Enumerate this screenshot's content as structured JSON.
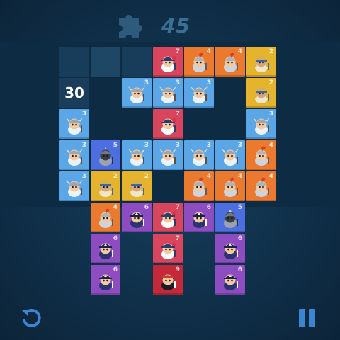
{
  "hud": {
    "moves_left": "45",
    "puzzle_icon": "puzzle-piece-icon"
  },
  "board": {
    "timer": "30",
    "columns": 7,
    "rows": 8,
    "tiles": [
      {
        "row": 0,
        "col": 0,
        "kind": "dark2"
      },
      {
        "row": 0,
        "col": 1,
        "kind": "dark"
      },
      {
        "row": 0,
        "col": 2,
        "kind": "dark2"
      },
      {
        "row": 0,
        "col": 3,
        "kind": "pink",
        "unit": "musketeer",
        "level": "7"
      },
      {
        "row": 0,
        "col": 4,
        "kind": "orange",
        "unit": "knight",
        "level": "4"
      },
      {
        "row": 0,
        "col": 5,
        "kind": "orange",
        "unit": "knight",
        "level": "4"
      },
      {
        "row": 0,
        "col": 6,
        "kind": "yellow",
        "unit": "pharaoh",
        "level": "2"
      },
      {
        "row": 1,
        "col": 0,
        "kind": "timer"
      },
      {
        "row": 1,
        "col": 2,
        "kind": "blue",
        "unit": "viking",
        "level": "3"
      },
      {
        "row": 1,
        "col": 3,
        "kind": "blue",
        "unit": "viking",
        "level": "3"
      },
      {
        "row": 1,
        "col": 4,
        "kind": "blue",
        "unit": "viking",
        "level": "3"
      },
      {
        "row": 1,
        "col": 6,
        "kind": "yellow",
        "unit": "pharaoh",
        "level": "2"
      },
      {
        "row": 2,
        "col": 0,
        "kind": "blue",
        "unit": "viking",
        "level": "3"
      },
      {
        "row": 2,
        "col": 3,
        "kind": "pink",
        "unit": "musketeer",
        "level": "7"
      },
      {
        "row": 2,
        "col": 6,
        "kind": "blue",
        "unit": "viking",
        "level": "3"
      },
      {
        "row": 3,
        "col": 0,
        "kind": "blue",
        "unit": "viking",
        "level": "3"
      },
      {
        "row": 3,
        "col": 1,
        "kind": "steel",
        "unit": "armor",
        "level": "5"
      },
      {
        "row": 3,
        "col": 2,
        "kind": "blue",
        "unit": "viking",
        "level": "3"
      },
      {
        "row": 3,
        "col": 3,
        "kind": "blue",
        "unit": "viking",
        "level": "3"
      },
      {
        "row": 3,
        "col": 4,
        "kind": "blue",
        "unit": "viking",
        "level": "3"
      },
      {
        "row": 3,
        "col": 5,
        "kind": "blue",
        "unit": "viking",
        "level": "3"
      },
      {
        "row": 3,
        "col": 6,
        "kind": "orange",
        "unit": "knight",
        "level": "4"
      },
      {
        "row": 4,
        "col": 0,
        "kind": "blue",
        "unit": "viking",
        "level": "3"
      },
      {
        "row": 4,
        "col": 1,
        "kind": "yellow",
        "unit": "pharaoh",
        "level": "2"
      },
      {
        "row": 4,
        "col": 2,
        "kind": "yellow",
        "unit": "pharaoh",
        "level": "2"
      },
      {
        "row": 4,
        "col": 4,
        "kind": "orange",
        "unit": "knight",
        "level": "4"
      },
      {
        "row": 4,
        "col": 5,
        "kind": "orange",
        "unit": "knight",
        "level": "4"
      },
      {
        "row": 4,
        "col": 6,
        "kind": "orange",
        "unit": "knight",
        "level": "4"
      },
      {
        "row": 5,
        "col": 1,
        "kind": "orange",
        "unit": "knight",
        "level": "4"
      },
      {
        "row": 5,
        "col": 2,
        "kind": "purple",
        "unit": "pirate",
        "level": "6"
      },
      {
        "row": 5,
        "col": 3,
        "kind": "pink",
        "unit": "musketeer",
        "level": "7"
      },
      {
        "row": 5,
        "col": 4,
        "kind": "purple",
        "unit": "pirate",
        "level": "6"
      },
      {
        "row": 5,
        "col": 5,
        "kind": "steel",
        "unit": "armor",
        "level": "5"
      },
      {
        "row": 6,
        "col": 1,
        "kind": "purple",
        "unit": "pirate",
        "level": "6"
      },
      {
        "row": 6,
        "col": 3,
        "kind": "pink",
        "unit": "musketeer",
        "level": "7"
      },
      {
        "row": 6,
        "col": 5,
        "kind": "purple",
        "unit": "pirate",
        "level": "6"
      },
      {
        "row": 7,
        "col": 1,
        "kind": "purple",
        "unit": "pirate",
        "level": "6"
      },
      {
        "row": 7,
        "col": 3,
        "kind": "red",
        "unit": "ninja",
        "level": "9"
      },
      {
        "row": 7,
        "col": 5,
        "kind": "purple",
        "unit": "pirate",
        "level": "6"
      }
    ]
  },
  "controls": {
    "undo_icon": "undo-icon",
    "pause_icon": "pause-icon"
  }
}
